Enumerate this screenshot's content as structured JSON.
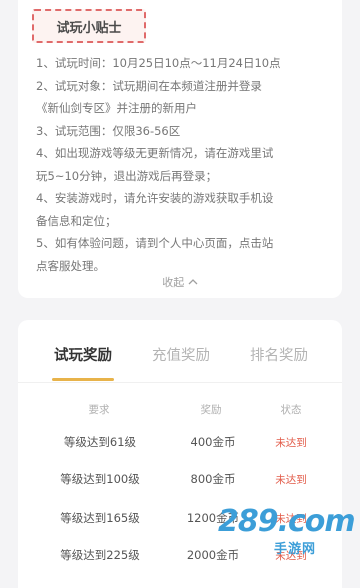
{
  "tips": {
    "title": "试玩小贴士",
    "items": [
      "1、试玩时间：10月25日10点～11月24日10点",
      "2、试玩对象：试玩期间在本频道注册并登录",
      "《新仙剑专区》并注册的新用户",
      "3、试玩范围：仅限36-56区",
      "4、如出现游戏等级无更新情况，请在游戏里试",
      "玩5~10分钟，退出游戏后再登录；",
      "4、安装游戏时，请允许安装的游戏获取手机设",
      "备信息和定位；",
      "5、如有体验问题，请到个人中心页面，点击站",
      "点客服处理。"
    ],
    "collapse_label": "收起",
    "collapse_icon": "chevron-up-icon"
  },
  "rewards": {
    "tabs": [
      "试玩奖励",
      "充值奖励",
      "排名奖励"
    ],
    "active_tab": "试玩奖励",
    "columns": [
      "要求",
      "奖励",
      "状态"
    ],
    "rows": [
      {
        "req": "等级达到61级",
        "reward": "400金币",
        "status": "未达到"
      },
      {
        "req": "等级达到100级",
        "reward": "800金币",
        "status": "未达到"
      },
      {
        "req": "等级达到165级",
        "reward": "1200金币",
        "status": "未达到"
      },
      {
        "req": "等级达到225级",
        "reward": "2000金币",
        "status": "未达到"
      }
    ]
  },
  "watermark": {
    "brand": "289.com",
    "sub": "手游网"
  },
  "colors": {
    "accent": "#e8b34a",
    "status": "#e25c4a",
    "title_border": "#e06a6a"
  }
}
